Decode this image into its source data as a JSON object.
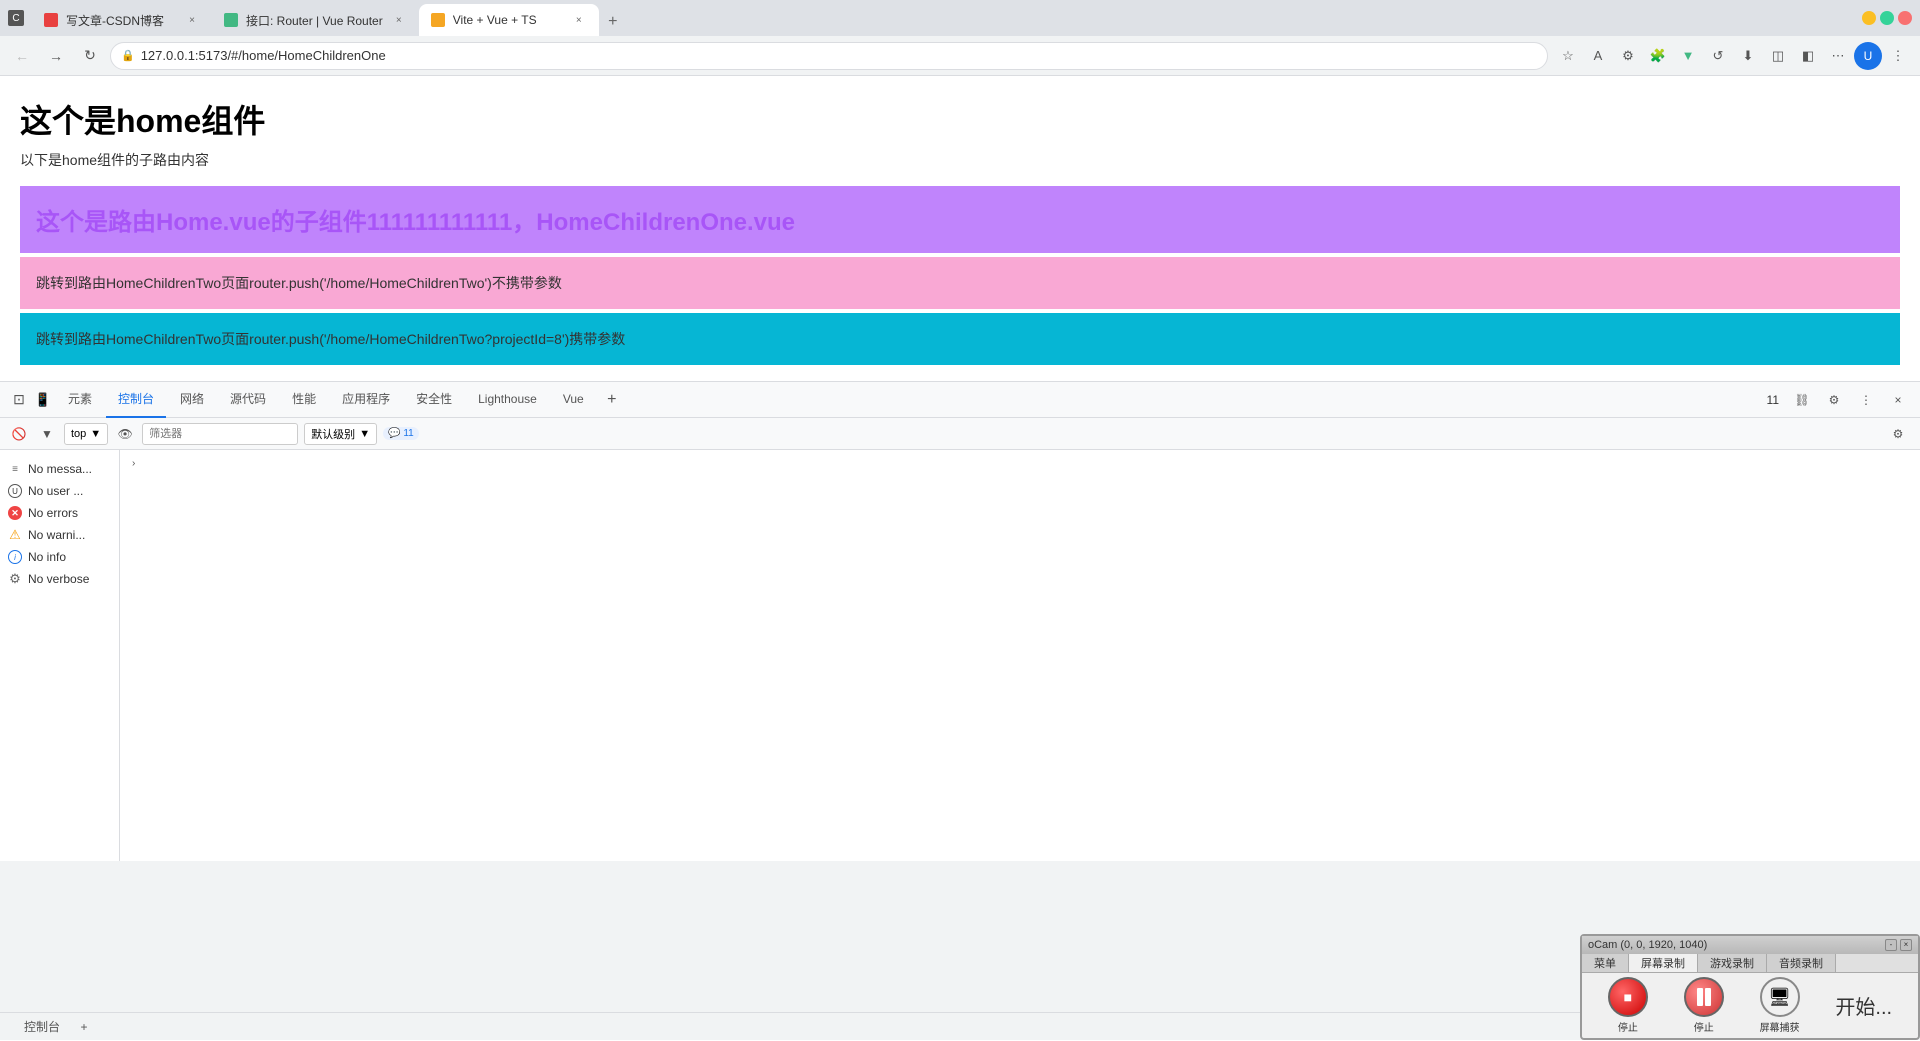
{
  "browser": {
    "tabs": [
      {
        "id": "tab1",
        "title": "写文章-CSDN博客",
        "favicon_color": "#e84040",
        "active": false,
        "close_label": "×"
      },
      {
        "id": "tab2",
        "title": "接口: Router | Vue Router",
        "favicon_color": "#42b883",
        "active": false,
        "close_label": "×"
      },
      {
        "id": "tab3",
        "title": "Vite + Vue + TS",
        "favicon_color": "#f5a623",
        "active": true,
        "close_label": "×"
      }
    ],
    "new_tab_label": "+",
    "address": "127.0.0.1:5173/#/home/HomeChildrenOne",
    "address_secure": "🔒",
    "nav": {
      "back_label": "←",
      "forward_label": "→",
      "refresh_label": "↻"
    }
  },
  "page": {
    "title": "这个是home组件",
    "subtitle": "以下是home组件的子路由内容",
    "component": {
      "bg_color": "#c084fc",
      "title": "这个是路由Home.vue的子组件111111111111，HomeChildrenOne.vue",
      "title_color": "#a855f7"
    },
    "link_pink": {
      "bg_color": "#f9a8d4",
      "text": "跳转到路由HomeChildrenTwo页面router.push('/home/HomeChildrenTwo')不携带参数"
    },
    "link_cyan": {
      "bg_color": "#06b6d4",
      "text": "跳转到路由HomeChildrenTwo页面router.push('/home/HomeChildrenTwo?projectId=8')携带参数"
    }
  },
  "devtools": {
    "tabs": [
      {
        "label": "元素",
        "active": false
      },
      {
        "label": "控制台",
        "active": true
      },
      {
        "label": "网络",
        "active": false
      },
      {
        "label": "源代码",
        "active": false
      },
      {
        "label": "性能",
        "active": false
      },
      {
        "label": "应用程序",
        "active": false
      },
      {
        "label": "安全性",
        "active": false
      },
      {
        "label": "Lighthouse",
        "active": false
      },
      {
        "label": "Vue",
        "active": false
      }
    ],
    "badge_count": "11",
    "toolbar": {
      "level_label": "top",
      "filter_placeholder": "筛选器",
      "default_levels_label": "默认级别",
      "badge_label": "11"
    },
    "sidebar": {
      "items": [
        {
          "label": "No messa...",
          "icon_type": "list"
        },
        {
          "label": "No user ...",
          "icon_type": "user"
        },
        {
          "label": "No errors",
          "icon_type": "error"
        },
        {
          "label": "No warni...",
          "icon_type": "warn"
        },
        {
          "label": "No info",
          "icon_type": "info"
        },
        {
          "label": "No verbose",
          "icon_type": "verbose"
        }
      ]
    }
  },
  "bottom_bar": {
    "tab_label": "控制台",
    "add_label": "+"
  },
  "ocam": {
    "title": "oCam (0, 0, 1920, 1040)",
    "min_label": "-",
    "close_label": "×",
    "tabs": [
      {
        "label": "菜单",
        "active": false
      },
      {
        "label": "屏幕录制",
        "active": true
      },
      {
        "label": "游戏录制",
        "active": false
      },
      {
        "label": "音频录制",
        "active": false
      }
    ],
    "buttons": [
      {
        "label": "停止",
        "type": "stop"
      },
      {
        "label": "停止",
        "type": "pause"
      },
      {
        "label": "屏幕捕获",
        "type": "screenshot"
      }
    ],
    "start_label": "开始..."
  }
}
